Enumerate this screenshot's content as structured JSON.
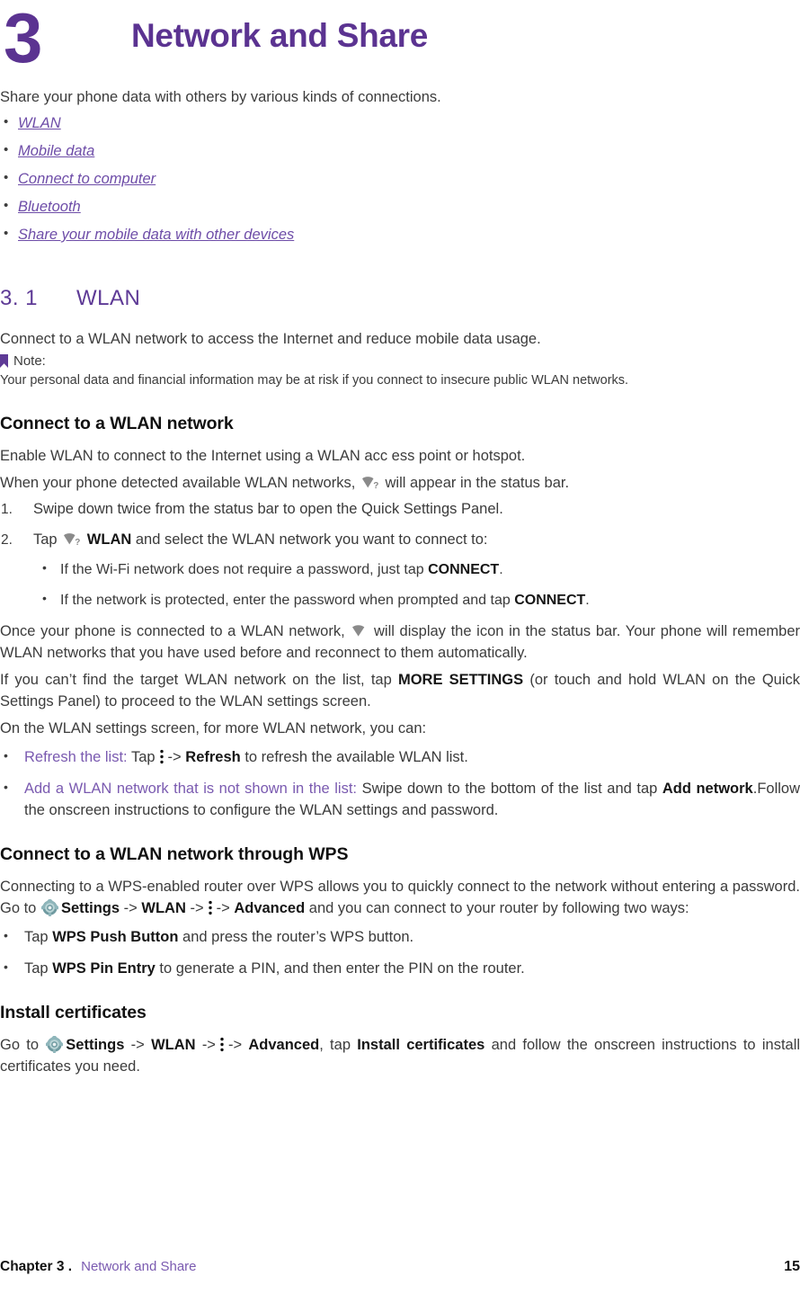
{
  "chapter": {
    "number": "3",
    "title": "Network and Share",
    "accent_color": "#5B3391"
  },
  "intro": {
    "text": "Share your phone data with others by various kinds of connections.",
    "links": [
      "WLAN",
      "Mobile data",
      "Connect to computer",
      "Bluetooth",
      "Share your mobile data with other devices"
    ]
  },
  "section": {
    "number": "3. 1",
    "name": "WLAN",
    "intro": "Connect to a WLAN network to access the Internet and reduce mobile data usage.",
    "note_label": "Note:",
    "note_body": "Your personal data and financial information may be at risk if you connect to insecure public WLAN networks."
  },
  "connect": {
    "heading": "Connect to a WLAN network",
    "p1": "Enable WLAN to connect to the Internet using a WLAN acc ess point or hotspot.",
    "p2_before": "When your phone detected available WLAN networks,",
    "p2_after": "will appear in the status bar.",
    "step1": "Swipe down twice from the status bar to open the Quick Settings Panel.",
    "step2_before": "Tap",
    "step2_bold": "WLAN",
    "step2_after": "and select the WLAN network you want to connect to:",
    "sub1_before": "If the Wi-Fi network does not require a password, just tap",
    "sub1_bold": "CONNECT",
    "sub1_after": ".",
    "sub2_before": "If the network is protected, enter the password when prompted and tap",
    "sub2_bold": "CONNECT",
    "sub2_after": ".",
    "p3_before": "Once your phone is connected to a WLAN network,",
    "p3_after": "will display the icon in the status bar. Your phone will remember WLAN networks that you have used before and reconnect to them automatically.",
    "p4_before": "If you can’t find the target WLAN network on the list, tap",
    "p4_bold": "MORE SETTINGS",
    "p4_after": "(or touch and hold WLAN on the Quick Settings Panel) to proceed to the WLAN settings screen.",
    "p5": "On the WLAN settings screen, for more WLAN network, you can:",
    "opt1_label": "Refresh the list:",
    "opt1_tap": "Tap",
    "opt1_arrow": "->",
    "opt1_bold": "Refresh",
    "opt1_after": "to refresh the available WLAN list.",
    "opt2_label": "Add a WLAN network that is not shown in the list:",
    "opt2_mid": "Swipe down to the bottom of the list and tap",
    "opt2_bold": "Add network",
    "opt2_after": ".Follow the onscreen instructions to configure the WLAN settings and password."
  },
  "wps": {
    "heading": "Connect to a WLAN network through WPS",
    "p1_a": "Connecting to a WPS-enabled router over WPS allows you to quickly connect to the network without entering a password. Go to",
    "p1_settings": "Settings",
    "p1_arrow1": "->",
    "p1_wlan": "WLAN",
    "p1_arrow2": "->",
    "p1_arrow3": "->",
    "p1_advanced": "Advanced",
    "p1_b": "and you can connect to your router by following two ways:",
    "b1_tap": "Tap",
    "b1_bold": "WPS Push Button",
    "b1_after": "and press the router’s WPS button.",
    "b2_tap": "Tap",
    "b2_bold": "WPS Pin Entry",
    "b2_after": "to generate a PIN, and then enter the PIN on the router."
  },
  "certificates": {
    "heading": "Install certificates",
    "p_a": "Go to",
    "p_settings": "Settings",
    "p_arrow1": "->",
    "p_wlan": "WLAN",
    "p_arrow2": "->",
    "p_arrow3": "->",
    "p_advanced": "Advanced",
    "p_comma": ", tap",
    "p_bold": "Install certificates",
    "p_b": "and follow the onscreen instructions to install certificates you need."
  },
  "footer": {
    "chapter_label": "Chapter 3 .",
    "section_label": "Network and Share",
    "page_number": "15"
  },
  "icons": {
    "wifi_question": "wifi-question-icon",
    "wifi": "wifi-icon",
    "kebab": "overflow-menu-icon",
    "gear": "settings-gear-icon",
    "note_flag": "note-flag-icon"
  }
}
